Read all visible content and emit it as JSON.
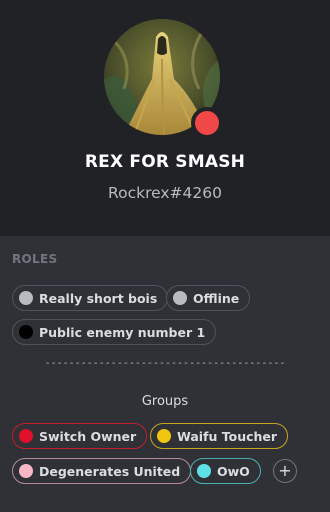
{
  "profile": {
    "username": "REX FOR SMASH",
    "tag": "Rockrex#4260",
    "status_color": "#f04747"
  },
  "roles": {
    "title": "ROLES",
    "items": [
      {
        "label": "Really short bois",
        "color": "#b9bbbe"
      },
      {
        "label": "Offline",
        "color": "#b9bbbe"
      },
      {
        "label": "Public enemy number 1",
        "color": "#000000"
      }
    ],
    "separator": "----------------------------------------",
    "groups_title": "Groups",
    "groups": [
      {
        "label": "Switch Owner",
        "color": "#e0102a",
        "border": "#c0202b"
      },
      {
        "label": "Waifu Toucher",
        "color": "#f1c40f",
        "border": "#c9a41c"
      },
      {
        "label": "Degenerates United",
        "color": "#f7b7c5",
        "border": "#b58b95"
      },
      {
        "label": "OwO",
        "color": "#5ee0e6",
        "border": "#4aaeb3"
      }
    ],
    "add_icon": "plus-icon"
  }
}
